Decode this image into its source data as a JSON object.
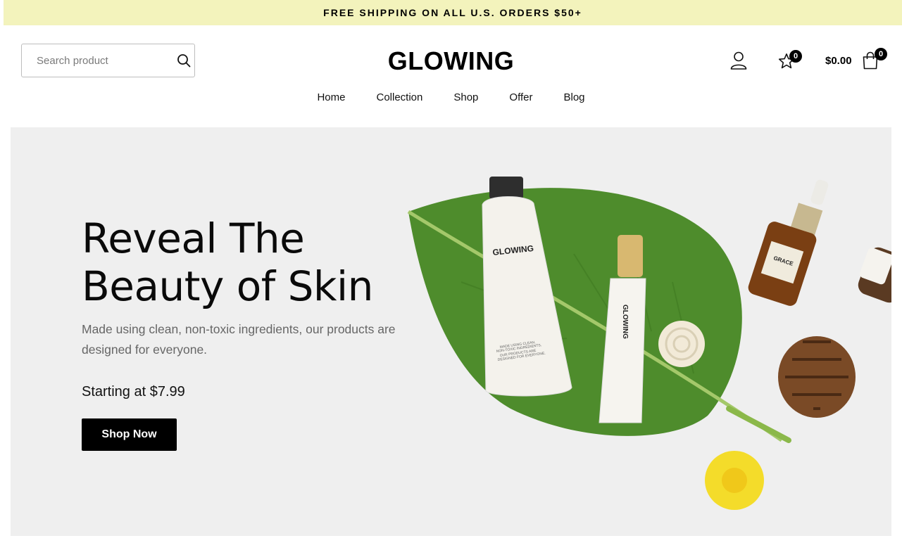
{
  "announcement": "FREE SHIPPING ON ALL U.S. ORDERS $50+",
  "search": {
    "placeholder": "Search product",
    "icon": "search-icon"
  },
  "logo": "GLOWING",
  "header": {
    "account_icon": "user-icon",
    "wishlist_icon": "star-icon",
    "wishlist_count": "0",
    "cart_total": "$0.00",
    "cart_icon": "shopping-bag-icon",
    "cart_count": "0"
  },
  "nav": [
    "Home",
    "Collection",
    "Shop",
    "Offer",
    "Blog"
  ],
  "hero": {
    "title_line1": "Reveal The",
    "title_line2": "Beauty of Skin",
    "description": "Made using clean, non-toxic ingredients, our products are designed for everyone.",
    "starting": "Starting at $7.99",
    "cta": "Shop Now",
    "product_label_1": "GLOWING",
    "product_label_2": "GLOWING",
    "product_small_text": "MADE USING CLEAN, NON-TOXIC INGREDIENTS, OUR PRODUCTS ARE DESIGNED FOR EVERYONE.",
    "bottle_label": "GRACE"
  },
  "colors": {
    "announcement_bg": "#f3f3bc",
    "hero_bg": "#efefef",
    "button_bg": "#000000",
    "leaf": "#4a8a2a"
  }
}
